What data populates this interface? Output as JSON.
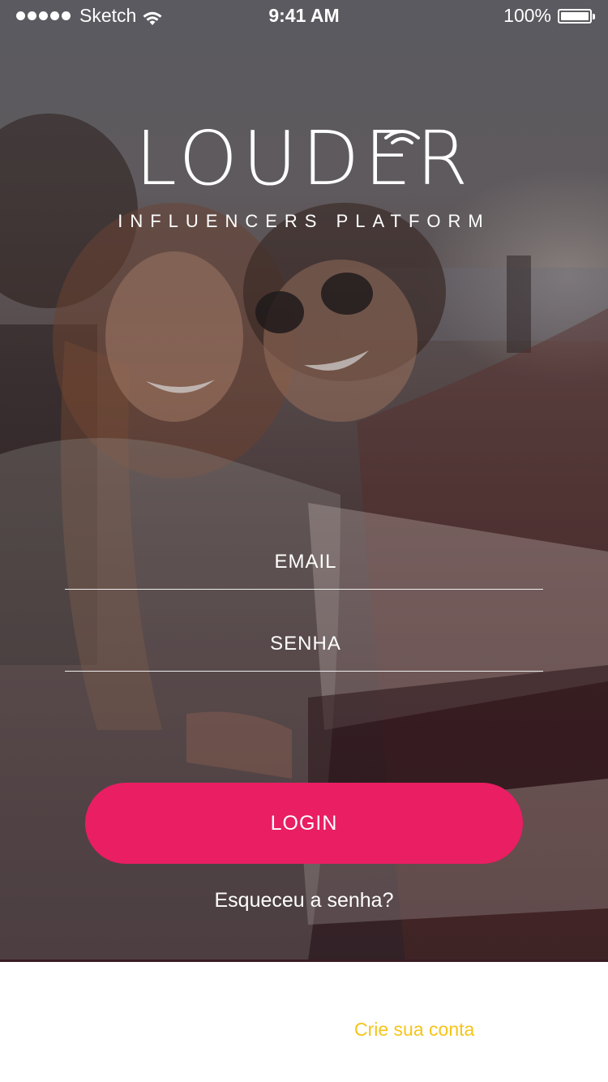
{
  "status_bar": {
    "carrier": "Sketch",
    "time": "9:41 AM",
    "battery": "100%",
    "icons": [
      "signal-icon",
      "wifi-icon",
      "battery-icon"
    ]
  },
  "logo": {
    "wordmark": "LOUDER",
    "tagline": "INFLUENCERS PLATFORM",
    "icon": "signal-waves-icon"
  },
  "form": {
    "email_placeholder": "EMAIL",
    "password_placeholder": "SENHA",
    "email_value": "",
    "password_value": ""
  },
  "actions": {
    "login_label": "LOGIN",
    "forgot_label": "Esqueceu a senha?",
    "signup_label": "Crie sua conta"
  },
  "colors": {
    "accent": "#e91e63",
    "link": "#f5c518",
    "text_light": "#ffffff"
  }
}
